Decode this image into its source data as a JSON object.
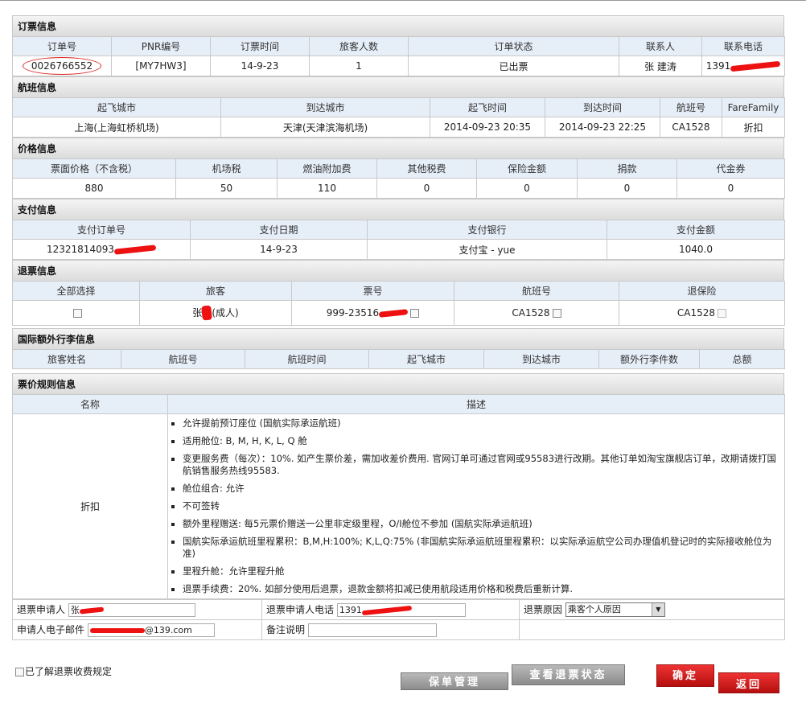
{
  "order": {
    "title": "订票信息",
    "headers": [
      "订单号",
      "PNR编号",
      "订票时间",
      "旅客人数",
      "订单状态",
      "联系人",
      "联系电话"
    ],
    "values": [
      "0026766552",
      "[MY7HW3]",
      "14-9-23",
      "1",
      "已出票",
      "张 建涛",
      "1391"
    ]
  },
  "flight": {
    "title": "航班信息",
    "headers": [
      "起飞城市",
      "到达城市",
      "起飞时间",
      "到达时间",
      "航班号",
      "FareFamily"
    ],
    "values": [
      "上海(上海虹桥机场)",
      "天津(天津滨海机场)",
      "2014-09-23 20:35",
      "2014-09-23 22:25",
      "CA1528",
      "折扣"
    ]
  },
  "price": {
    "title": "价格信息",
    "headers": [
      "票面价格（不含税）",
      "机场税",
      "燃油附加费",
      "其他税费",
      "保险金额",
      "捐款",
      "代金券"
    ],
    "values": [
      "880",
      "50",
      "110",
      "0",
      "0",
      "0",
      "0"
    ]
  },
  "payment": {
    "title": "支付信息",
    "headers": [
      "支付订单号",
      "支付日期",
      "支付银行",
      "支付金额"
    ],
    "values": [
      "12321814093",
      "14-9-23",
      "支付宝 - yue",
      "1040.0"
    ]
  },
  "refund": {
    "title": "退票信息",
    "headers": [
      "全部选择",
      "旅客",
      "票号",
      "航班号",
      "退保险"
    ],
    "passenger_prefix": "张",
    "passenger_suffix": "(成人)",
    "ticket_no": "999-23516",
    "flight_no": "CA1528",
    "insurance_flight": "CA1528"
  },
  "baggage": {
    "title": "国际额外行李信息",
    "headers": [
      "旅客姓名",
      "航班号",
      "航班时间",
      "起飞城市",
      "到达城市",
      "额外行李件数",
      "总额"
    ]
  },
  "rules": {
    "title": "票价规则信息",
    "headers": [
      "名称",
      "描述"
    ],
    "name": "折扣",
    "items": [
      "允许提前预订座位 (国航实际承运航班)",
      "适用舱位: B, M, H, K, L, Q 舱",
      "变更服务费（每次）：10%. 如产生票价差，需加收差价费用. 官网订单可通过官网或95583进行改期。其他订单如淘宝旗舰店订单，改期请拨打国航销售服务热线95583.",
      "舱位组合: 允许",
      "不可签转",
      "额外里程赠送: 每5元票价赠送一公里非定级里程，O/I舱位不参加 (国航实际承运航班)",
      "国航实际承运航班里程累积：B,M,H:100%; K,L,Q:75% (非国航实际承运航班里程累积：以实际承运航空公司办理值机登记时的实际接收舱位为准)",
      "里程升舱：允许里程升舱",
      "退票手续费：20%. 如部分使用后退票，退款金额将扣减已使用航段适用价格和税费后重新计算."
    ]
  },
  "form": {
    "applicant_label": "退票申请人",
    "applicant_value": "张",
    "phone_label": "退票申请人电话",
    "phone_value": "1391",
    "reason_label": "退票原因",
    "reason_value": "乘客个人原因",
    "email_label": "申请人电子邮件",
    "email_value": "@139.com",
    "remark_label": "备注说明",
    "remark_value": ""
  },
  "agree_label": "已了解退票收费规定",
  "buttons": {
    "manage": "保单管理",
    "status": "查看退票状态",
    "confirm": "确定",
    "back": "返回"
  }
}
